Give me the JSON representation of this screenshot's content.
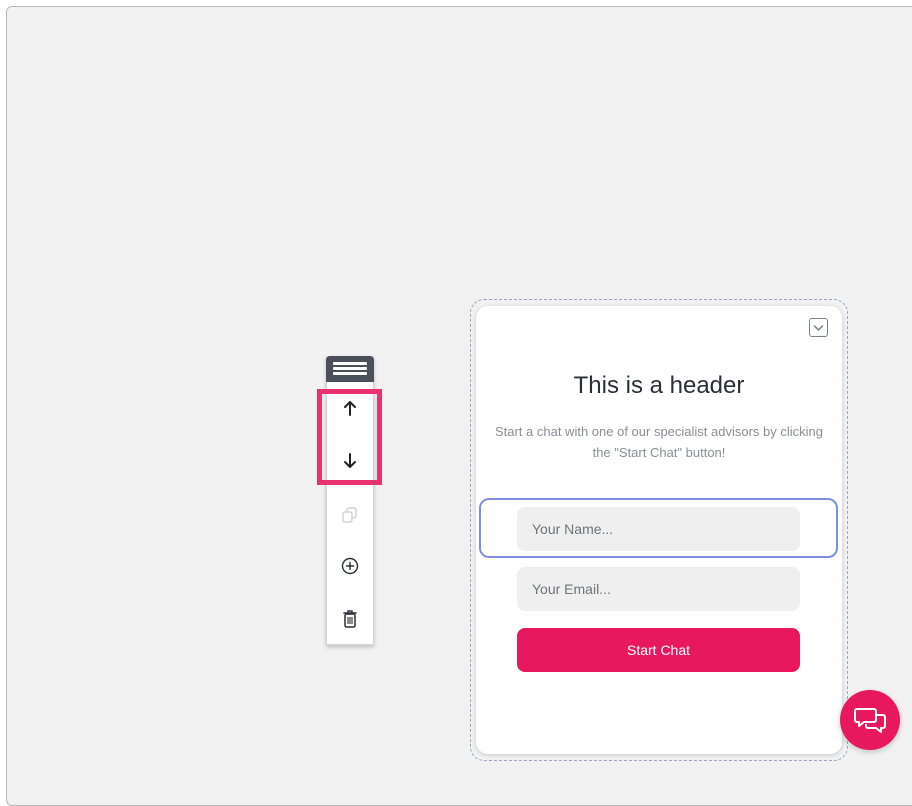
{
  "toolbar": {
    "items": [
      {
        "name": "move-up",
        "icon": "arrow-up-icon"
      },
      {
        "name": "move-down",
        "icon": "arrow-down-icon"
      },
      {
        "name": "duplicate",
        "icon": "duplicate-icon",
        "disabled": true
      },
      {
        "name": "add",
        "icon": "plus-circle-icon"
      },
      {
        "name": "delete",
        "icon": "trash-icon"
      }
    ]
  },
  "widget": {
    "header": "This is a header",
    "description": "Start a chat with one of our specialist advisors by clicking the \"Start Chat\" button!",
    "name_placeholder": "Your Name...",
    "email_placeholder": "Your Email...",
    "start_button": "Start Chat"
  },
  "colors": {
    "accent": "#e8185e",
    "highlight": "#e8336e",
    "selection": "#7d8fe3",
    "handle": "#4a4f5a"
  }
}
